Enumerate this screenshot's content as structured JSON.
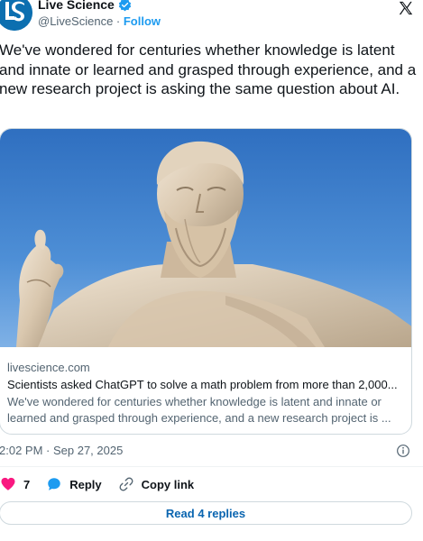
{
  "author": {
    "name": "Live Science",
    "handle": "@LiveScience",
    "separator": " · ",
    "follow_label": "Follow",
    "avatar_letters": "LS"
  },
  "tweet": {
    "text": "We've wondered for centuries whether knowledge is latent and innate or learned and grasped through experience, and a new research project is asking the same question about AI."
  },
  "card": {
    "domain": "livescience.com",
    "title": "Scientists asked ChatGPT to solve a math problem from more than 2,000...",
    "description": "We've wondered for centuries whether knowledge is latent and innate or learned and grasped through experience, and a new research project is ..."
  },
  "meta": {
    "timestamp": "2:02 PM · Sep 27, 2025"
  },
  "actions": {
    "like_count": "7",
    "reply_label": "Reply",
    "copy_link_label": "Copy link"
  },
  "replies": {
    "label": "Read 4 replies"
  },
  "colors": {
    "accent": "#1d9bf0",
    "like": "#f91880",
    "reply": "#1d9bf0",
    "link": "#0a65b0"
  }
}
